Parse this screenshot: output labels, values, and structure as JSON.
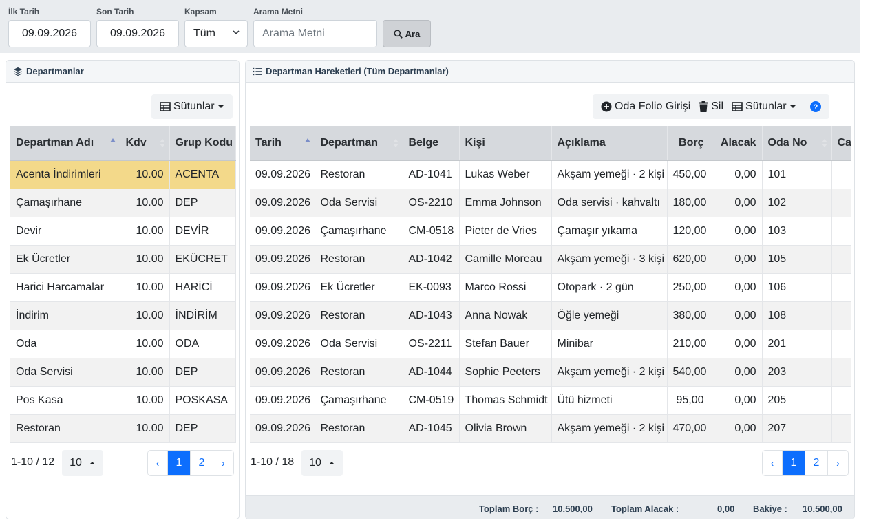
{
  "filters": {
    "start_label": "İlk Tarih",
    "start_value": "09.09.2026",
    "end_label": "Son Tarih",
    "end_value": "09.09.2026",
    "scope_label": "Kapsam",
    "scope_value": "Tüm",
    "search_label": "Arama Metni",
    "search_placeholder": "Arama Metni",
    "search_button": "Ara"
  },
  "departments": {
    "title": "Departmanlar",
    "columns_button": "Sütunlar",
    "headers": [
      "Departman Adı",
      "Kdv",
      "Grup Kodu"
    ],
    "rows": [
      {
        "name": "Acenta İndirimleri",
        "kdv": "10.00",
        "code": "ACENTA"
      },
      {
        "name": "Çamaşırhane",
        "kdv": "10.00",
        "code": "DEP"
      },
      {
        "name": "Devir",
        "kdv": "10.00",
        "code": "DEVİR"
      },
      {
        "name": "Ek Ücretler",
        "kdv": "10.00",
        "code": "EKÜCRET"
      },
      {
        "name": "Harici Harcamalar",
        "kdv": "10.00",
        "code": "HARİCİ"
      },
      {
        "name": "İndirim",
        "kdv": "10.00",
        "code": "İNDİRİM"
      },
      {
        "name": "Oda",
        "kdv": "10.00",
        "code": "ODA"
      },
      {
        "name": "Oda Servisi",
        "kdv": "10.00",
        "code": "DEP"
      },
      {
        "name": "Pos Kasa",
        "kdv": "10.00",
        "code": "POSKASA"
      },
      {
        "name": "Restoran",
        "kdv": "10.00",
        "code": "DEP"
      }
    ],
    "range": "1-10 / 12",
    "page_size": "10",
    "pages": [
      "‹",
      "1",
      "2",
      "›"
    ]
  },
  "movements": {
    "title": "Departman Hareketleri (Tüm Departmanlar)",
    "add_button": "Oda Folio Girişi",
    "delete_button": "Sil",
    "columns_button": "Sütunlar",
    "headers": [
      "Tarih",
      "Departman",
      "Belge",
      "Kişi",
      "Açıklama",
      "Borç",
      "Alacak",
      "Oda No",
      "Ca"
    ],
    "rows": [
      {
        "date": "09.09.2026",
        "dept": "Restoran",
        "doc": "AD-1041",
        "person": "Lukas Weber",
        "desc": "Akşam yemeği · 2 kişi",
        "debit": "450,00",
        "credit": "0,00",
        "room": "101"
      },
      {
        "date": "09.09.2026",
        "dept": "Oda Servisi",
        "doc": "OS-2210",
        "person": "Emma Johnson",
        "desc": "Oda servisi · kahvaltı",
        "debit": "180,00",
        "credit": "0,00",
        "room": "102"
      },
      {
        "date": "09.09.2026",
        "dept": "Çamaşırhane",
        "doc": "CM-0518",
        "person": "Pieter de Vries",
        "desc": "Çamaşır yıkama",
        "debit": "120,00",
        "credit": "0,00",
        "room": "103"
      },
      {
        "date": "09.09.2026",
        "dept": "Restoran",
        "doc": "AD-1042",
        "person": "Camille Moreau",
        "desc": "Akşam yemeği · 3 kişi",
        "debit": "620,00",
        "credit": "0,00",
        "room": "105"
      },
      {
        "date": "09.09.2026",
        "dept": "Ek Ücretler",
        "doc": "EK-0093",
        "person": "Marco Rossi",
        "desc": "Otopark · 2 gün",
        "debit": "250,00",
        "credit": "0,00",
        "room": "106"
      },
      {
        "date": "09.09.2026",
        "dept": "Restoran",
        "doc": "AD-1043",
        "person": "Anna Nowak",
        "desc": "Öğle yemeği",
        "debit": "380,00",
        "credit": "0,00",
        "room": "108"
      },
      {
        "date": "09.09.2026",
        "dept": "Oda Servisi",
        "doc": "OS-2211",
        "person": "Stefan Bauer",
        "desc": "Minibar",
        "debit": "210,00",
        "credit": "0,00",
        "room": "201"
      },
      {
        "date": "09.09.2026",
        "dept": "Restoran",
        "doc": "AD-1044",
        "person": "Sophie Peeters",
        "desc": "Akşam yemeği · 2 kişi",
        "debit": "540,00",
        "credit": "0,00",
        "room": "203"
      },
      {
        "date": "09.09.2026",
        "dept": "Çamaşırhane",
        "doc": "CM-0519",
        "person": "Thomas Schmidt",
        "desc": "Ütü hizmeti",
        "debit": "95,00",
        "credit": "0,00",
        "room": "205"
      },
      {
        "date": "09.09.2026",
        "dept": "Restoran",
        "doc": "AD-1045",
        "person": "Olivia Brown",
        "desc": "Akşam yemeği · 2 kişi",
        "debit": "470,00",
        "credit": "0,00",
        "room": "207"
      }
    ],
    "range": "1-10 / 18",
    "page_size": "10",
    "pages": [
      "‹",
      "1",
      "2",
      "›"
    ]
  },
  "totals": {
    "debit_label": "Toplam Borç :",
    "debit_value": "10.500,00",
    "credit_label": "Toplam Alacak :",
    "credit_value": "0,00",
    "balance_label": "Bakiye :",
    "balance_value": "10.500,00"
  },
  "colors": {
    "selected_row": "#f3d98a",
    "primary": "#0d6efd"
  }
}
